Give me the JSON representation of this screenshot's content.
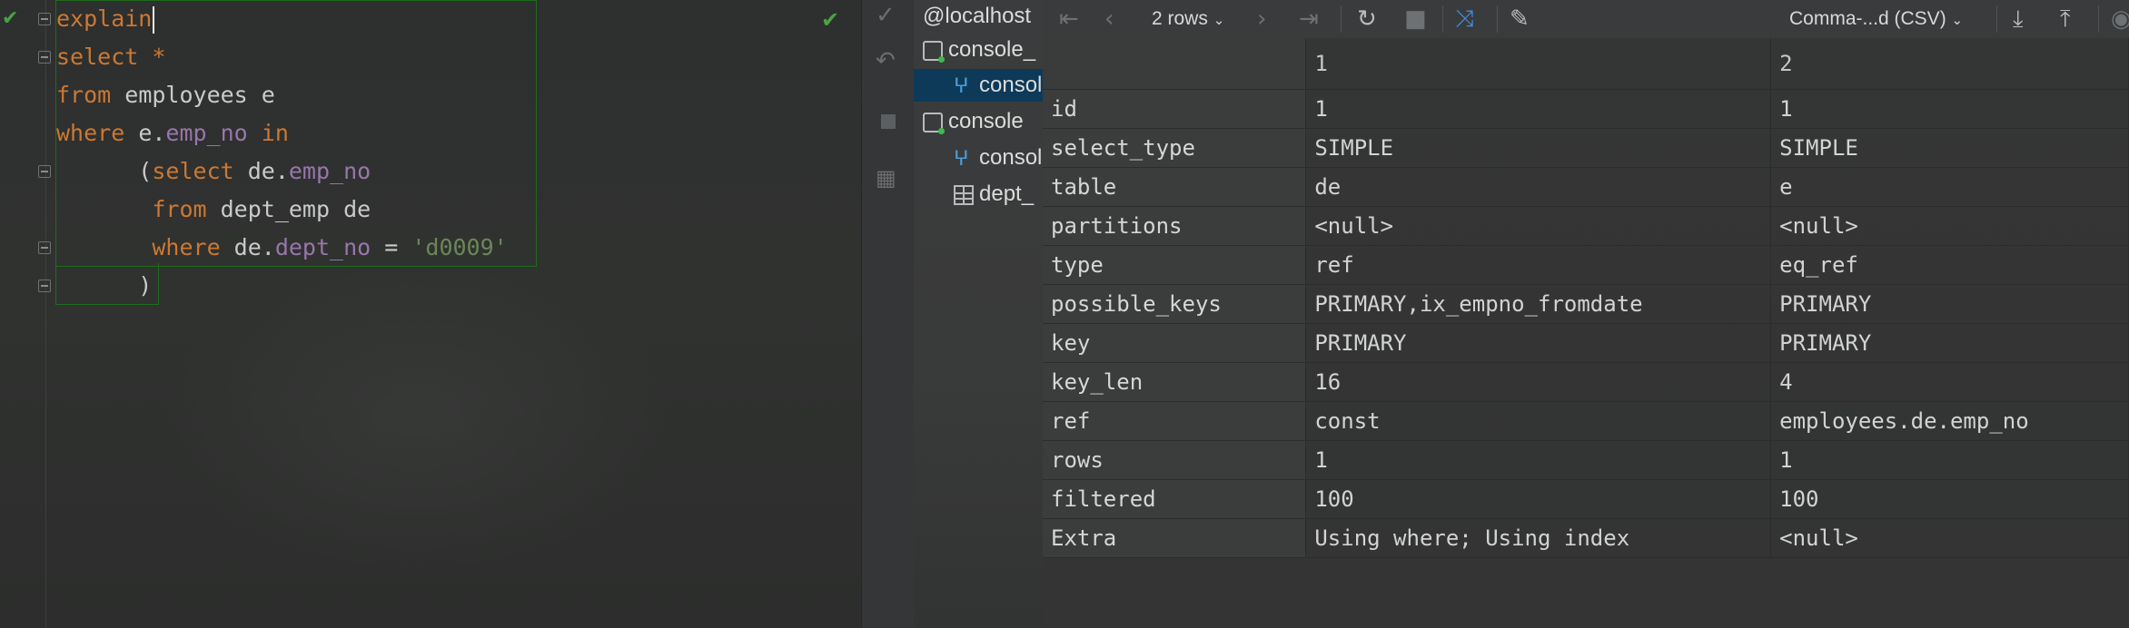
{
  "editor": {
    "lines": [
      {
        "parts": [
          {
            "t": "explain",
            "c": "kw"
          }
        ],
        "caret": true
      },
      {
        "parts": [
          {
            "t": "select ",
            "c": "kw"
          },
          {
            "t": "*",
            "c": "kw"
          }
        ]
      },
      {
        "parts": [
          {
            "t": "from ",
            "c": "kw"
          },
          {
            "t": "employees e",
            "c": ""
          }
        ]
      },
      {
        "parts": [
          {
            "t": "where ",
            "c": "kw"
          },
          {
            "t": "e.",
            "c": ""
          },
          {
            "t": "emp_no",
            "c": "fld"
          },
          {
            "t": " in",
            "c": "kw"
          }
        ]
      },
      {
        "parts": [
          {
            "t": "      (",
            "c": ""
          },
          {
            "t": "select ",
            "c": "kw"
          },
          {
            "t": "de.",
            "c": ""
          },
          {
            "t": "emp_no",
            "c": "fld"
          }
        ]
      },
      {
        "parts": [
          {
            "t": "       from ",
            "c": "kw"
          },
          {
            "t": "dept_emp de",
            "c": ""
          }
        ]
      },
      {
        "parts": [
          {
            "t": "       where ",
            "c": "kw"
          },
          {
            "t": "de.",
            "c": ""
          },
          {
            "t": "dept_no",
            "c": "fld"
          },
          {
            "t": " = ",
            "c": ""
          },
          {
            "t": "'d0009'",
            "c": "str"
          }
        ]
      },
      {
        "parts": [
          {
            "t": "      )",
            "c": ""
          }
        ]
      }
    ]
  },
  "tree": {
    "items": [
      {
        "label": "@localhost",
        "icon": "none"
      },
      {
        "label": "console_",
        "icon": "database-icon"
      },
      {
        "label": "console",
        "icon": "console-icon",
        "selected": true
      },
      {
        "label": "console",
        "icon": "database-icon"
      },
      {
        "label": "console",
        "icon": "console-icon"
      },
      {
        "label": "dept_",
        "icon": "table-icon"
      }
    ]
  },
  "toolbar": {
    "rows_label": "2 rows",
    "format_label": "Comma-...d (CSV)"
  },
  "results": {
    "columns": [
      "1",
      "2"
    ],
    "rows": [
      {
        "name": "id",
        "v1": "1",
        "v2": "1"
      },
      {
        "name": "select_type",
        "v1": "SIMPLE",
        "v2": "SIMPLE"
      },
      {
        "name": "table",
        "v1": "de",
        "v2": "e"
      },
      {
        "name": "partitions",
        "v1": "<null>",
        "v2": "<null>"
      },
      {
        "name": "type",
        "v1": "ref",
        "v2": "eq_ref"
      },
      {
        "name": "possible_keys",
        "v1": "PRIMARY,ix_empno_fromdate",
        "v2": "PRIMARY"
      },
      {
        "name": "key",
        "v1": "PRIMARY",
        "v2": "PRIMARY"
      },
      {
        "name": "key_len",
        "v1": "16",
        "v2": "4"
      },
      {
        "name": "ref",
        "v1": "const",
        "v2": "employees.de.emp_no"
      },
      {
        "name": "rows",
        "v1": "1",
        "v2": "1"
      },
      {
        "name": "filtered",
        "v1": "100",
        "v2": "100"
      },
      {
        "name": "Extra",
        "v1": "Using where; Using index",
        "v2": "<null>"
      }
    ]
  },
  "colors": {
    "keyword": "#cc7832",
    "field": "#9876aa",
    "string": "#6a8759",
    "check": "#4aa341",
    "selection": "#0d3a58"
  }
}
